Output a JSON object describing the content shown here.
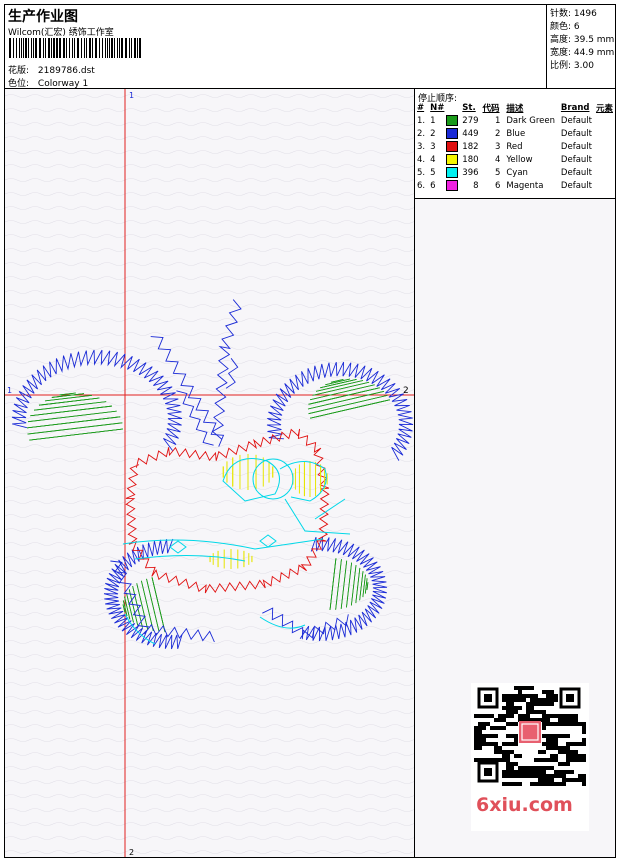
{
  "header": {
    "title": "生产作业图",
    "subtitle": "Wilcom(汇宏) 绣饰工作室",
    "design_label": "花版:",
    "design_value": "2189786.dst",
    "colorway_label": "色位:",
    "colorway_value": "Colorway 1"
  },
  "stats": {
    "stitches": "针数: 1496",
    "colors": "颜色: 6",
    "height": "高度: 39.5 mm",
    "width": "宽度: 44.9 mm",
    "scale": "比例: 3.00"
  },
  "stop_sequence": {
    "title": "停止顺序:",
    "columns": [
      "#",
      "N#",
      "St.",
      "代码",
      "描述",
      "Brand",
      "元素"
    ],
    "rows": [
      {
        "idx": "1.",
        "n": "1",
        "color": "#1a9a1a",
        "st": "279",
        "code": "1",
        "desc": "Dark Green",
        "brand": "Default"
      },
      {
        "idx": "2.",
        "n": "2",
        "color": "#1a2ad6",
        "st": "449",
        "code": "2",
        "desc": "Blue",
        "brand": "Default"
      },
      {
        "idx": "3.",
        "n": "3",
        "color": "#e01010",
        "st": "182",
        "code": "3",
        "desc": "Red",
        "brand": "Default"
      },
      {
        "idx": "4.",
        "n": "4",
        "color": "#f5f500",
        "st": "180",
        "code": "4",
        "desc": "Yellow",
        "brand": "Default"
      },
      {
        "idx": "5.",
        "n": "5",
        "color": "#00f0f0",
        "st": "396",
        "code": "5",
        "desc": "Cyan",
        "brand": "Default"
      },
      {
        "idx": "6.",
        "n": "6",
        "color": "#f020e0",
        "st": "8",
        "code": "6",
        "desc": "Magenta",
        "brand": "Default"
      }
    ]
  },
  "axes": {
    "top": "1",
    "bottom": "2",
    "left": "1",
    "right": "2"
  },
  "watermark": "6xiu.com",
  "colors": {
    "dark_green": "#1a9a1a",
    "blue": "#1a2ad6",
    "red": "#e01010",
    "yellow": "#f5f500",
    "cyan": "#00e0e8",
    "guide": "#e02020"
  }
}
